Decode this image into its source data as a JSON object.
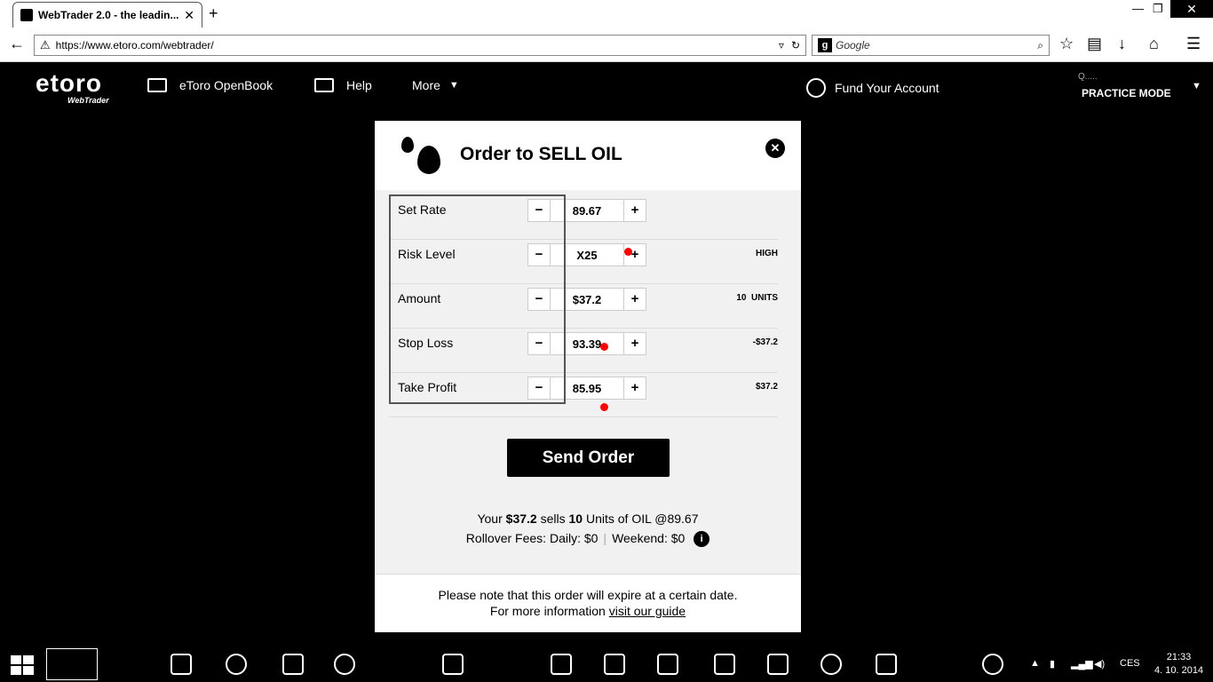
{
  "browser": {
    "tab_title": "WebTrader 2.0 - the leadin...",
    "url": "https://www.etoro.com/webtrader/",
    "search_placeholder": "Google"
  },
  "header": {
    "logo": "etoro",
    "logo_sub": "WebTrader",
    "nav": [
      {
        "label": "eToro OpenBook"
      },
      {
        "label": "Help"
      },
      {
        "label": "More"
      }
    ],
    "fund": "Fund Your Account",
    "user": "Q.....",
    "mode": "PRACTICE MODE"
  },
  "order": {
    "title": "Order to SELL OIL",
    "rows": [
      {
        "label": "Set Rate",
        "value": "89.67",
        "info": ""
      },
      {
        "label": "Risk Level",
        "value": "X25",
        "info": "HIGH"
      },
      {
        "label": "Amount",
        "value": "$37.2",
        "info": "10  UNITS"
      },
      {
        "label": "Stop Loss",
        "value": "93.39",
        "info": "-$37.2"
      },
      {
        "label": "Take Profit",
        "value": "85.95",
        "info": "$37.2"
      }
    ],
    "send_label": "Send Order",
    "summary": {
      "pre": "Your ",
      "amount": "$37.2",
      "mid": " sells ",
      "units": "10",
      "post": " Units of OIL @89.67"
    },
    "fees": {
      "label": "Rollover Fees:",
      "daily": "Daily: $0",
      "weekend": "Weekend: $0"
    },
    "note_line1": "Please note that this order will expire at a certain date.",
    "note_pre": "For more information ",
    "note_link": "visit our guide"
  },
  "taskbar": {
    "lang": "CES",
    "time": "21:33",
    "date": "4. 10. 2014"
  }
}
